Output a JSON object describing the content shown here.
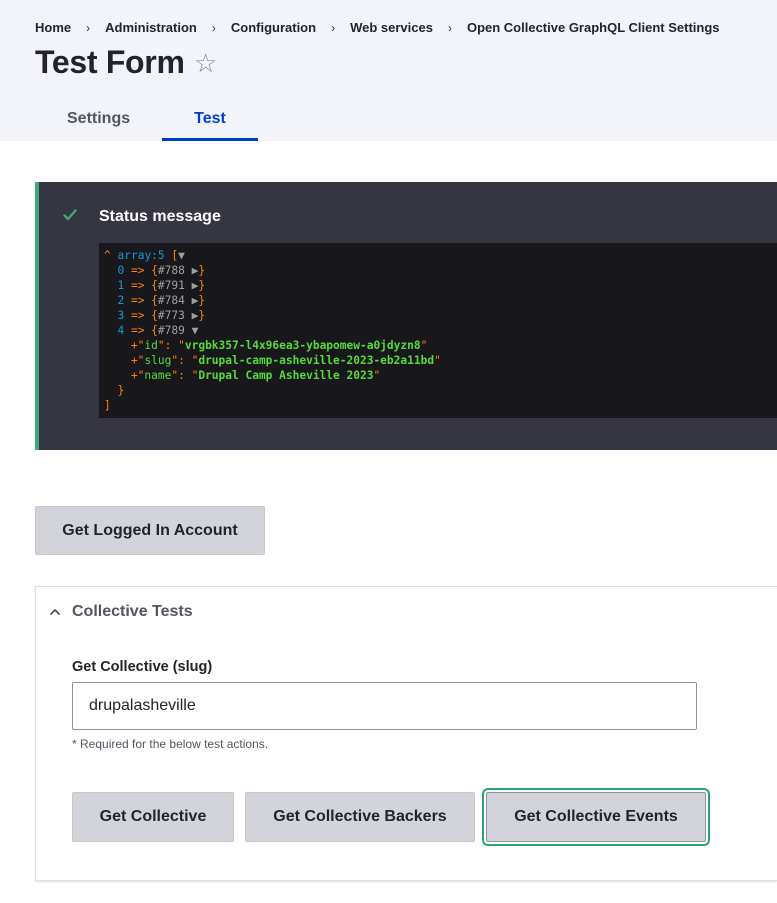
{
  "breadcrumb": [
    "Home",
    "Administration",
    "Configuration",
    "Web services",
    "Open Collective GraphQL Client Settings"
  ],
  "breadcrumb_separator": "›",
  "page": {
    "title": "Test Form",
    "star_glyph": "☆"
  },
  "tabs": [
    {
      "label": "Settings",
      "active": false
    },
    {
      "label": "Test",
      "active": true
    }
  ],
  "status": {
    "title": "Status message",
    "dump": {
      "header_caret": "^",
      "header_type": "array:5",
      "header_open": "[",
      "header_toggle": "▼",
      "rows": [
        {
          "index": "0",
          "ref": "#788"
        },
        {
          "index": "1",
          "ref": "#791"
        },
        {
          "index": "2",
          "ref": "#784"
        },
        {
          "index": "3",
          "ref": "#773"
        }
      ],
      "open_row": {
        "index": "4",
        "ref": "#789"
      },
      "props": [
        {
          "key": "id",
          "value": "vrgbk357-l4x96ea3-ybapomew-a0jdyzn8"
        },
        {
          "key": "slug",
          "value": "drupal-camp-asheville-2023-eb2a11bd"
        },
        {
          "key": "name",
          "value": "Drupal Camp Asheville 2023"
        }
      ]
    }
  },
  "buttons": {
    "logged_in": "Get Logged In Account",
    "collective": "Get Collective",
    "backers": "Get Collective Backers",
    "events": "Get Collective Events"
  },
  "details": {
    "summary": "Collective Tests",
    "field_label": "Get Collective (slug)",
    "field_value": "drupalasheville",
    "field_description": "* Required for the below test actions."
  },
  "colors": {
    "accent": "#003ecc",
    "status_border": "#42a877",
    "focus": "#26a769"
  }
}
